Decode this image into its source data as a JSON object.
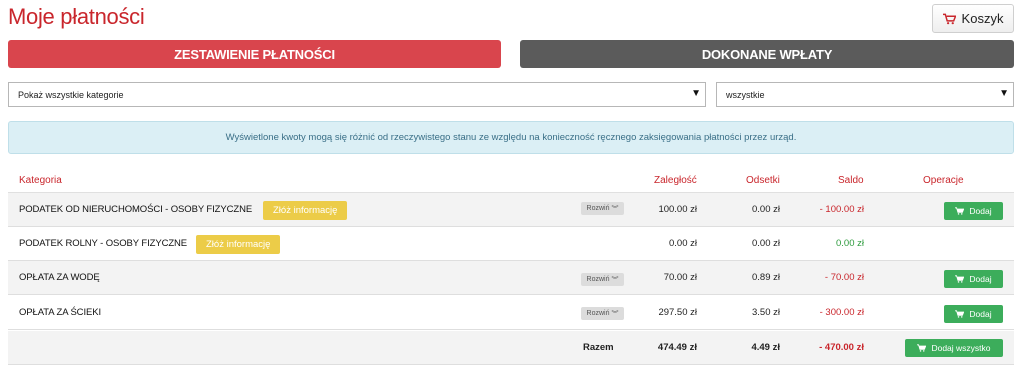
{
  "page": {
    "title": "Moje płatności"
  },
  "cart": {
    "label": "Koszyk",
    "icon": "cart-icon"
  },
  "tabs": [
    {
      "label": "ZESTAWIENIE PŁATNOŚCI",
      "active": true,
      "color": "#d9454d"
    },
    {
      "label": "DOKONANE WPŁATY",
      "active": false,
      "color": "#5b5b5b"
    }
  ],
  "filters": {
    "category": {
      "value": "Pokaż wszystkie kategorie"
    },
    "status": {
      "value": "wszystkie"
    }
  },
  "info": {
    "text": "Wyświetlone kwoty mogą się różnić od rzeczywistego stanu ze względu na konieczność ręcznego zaksięgowania płatności przez urząd."
  },
  "table": {
    "headers": {
      "category": "Kategoria",
      "arrears": "Zaległość",
      "interest": "Odsetki",
      "balance": "Saldo",
      "operations": "Operacje"
    },
    "expand_label": "Rozwiń",
    "add_label": "Dodaj",
    "submit_info_label": "Złóż informację",
    "rows": [
      {
        "category": "PODATEK OD NIERUCHOMOŚCI - OSOBY FIZYCZNE",
        "arrears": "100.00 zł",
        "interest": "0.00 zł",
        "balance": "- 100.00 zł"
      },
      {
        "category": "PODATEK ROLNY - OSOBY FIZYCZNE",
        "arrears": "0.00 zł",
        "interest": "0.00 zł",
        "balance": "0.00 zł"
      },
      {
        "category": "OPŁATA ZA WODĘ",
        "arrears": "70.00 zł",
        "interest": "0.89 zł",
        "balance": "- 70.00 zł"
      },
      {
        "category": "OPŁATA ZA ŚCIEKI",
        "arrears": "297.50 zł",
        "interest": "3.50 zł",
        "balance": "- 300.00 zł"
      }
    ],
    "total": {
      "label": "Razem",
      "arrears": "474.49 zł",
      "interest": "4.49 zł",
      "balance": "- 470.00 zł",
      "add_all_label": "Dodaj wszystko"
    }
  },
  "colors": {
    "accent_red": "#c9262c",
    "success_green": "#3cad5b",
    "warning_yellow": "#eccc48",
    "info_bg": "#dbeff5"
  }
}
